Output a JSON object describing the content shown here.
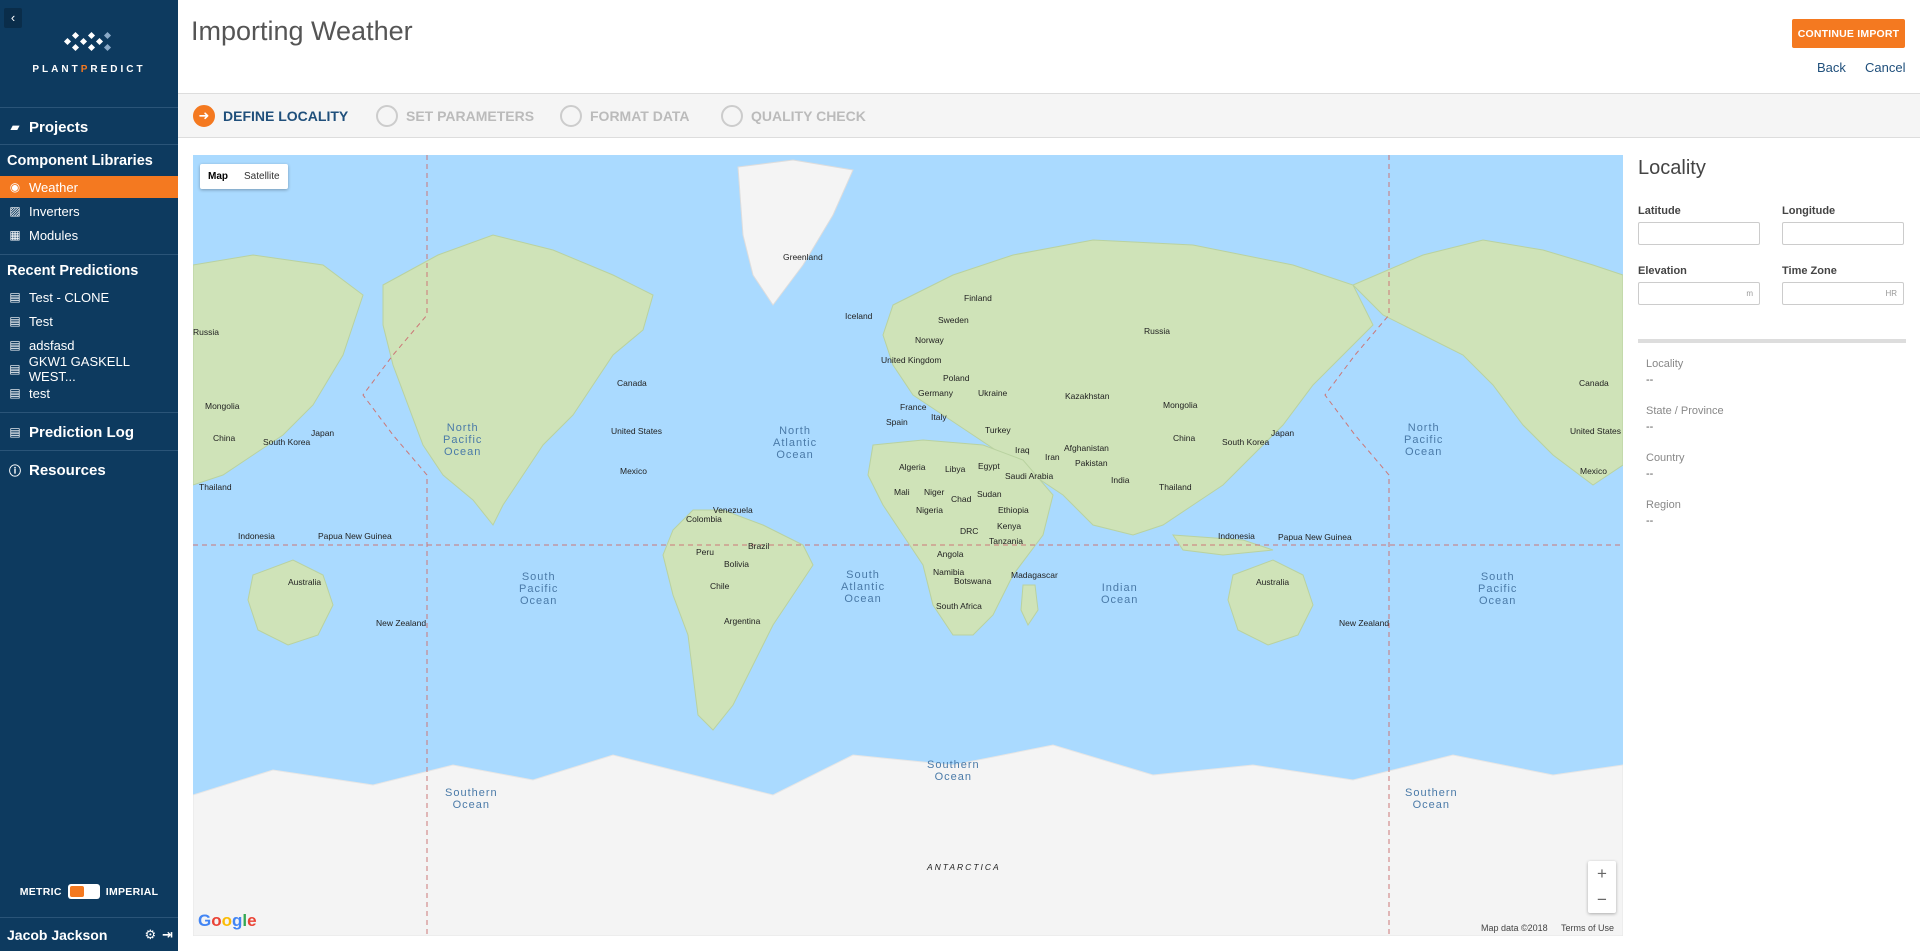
{
  "sidebar": {
    "logo": "PLANTPREDICT",
    "projects": "Projects",
    "component_libraries": "Component Libraries",
    "libraries": [
      {
        "label": "Weather"
      },
      {
        "label": "Inverters"
      },
      {
        "label": "Modules"
      }
    ],
    "recent_predictions": "Recent Predictions",
    "recent": [
      {
        "label": "Test - CLONE"
      },
      {
        "label": "Test"
      },
      {
        "label": "adsfasd"
      },
      {
        "label": "GKW1 GASKELL WEST..."
      },
      {
        "label": "test"
      }
    ],
    "prediction_log": "Prediction Log",
    "resources": "Resources",
    "metric": "METRIC",
    "imperial": "IMPERIAL",
    "user": "Jacob Jackson"
  },
  "header": {
    "title": "Importing Weather",
    "continue": "CONTINUE IMPORT",
    "back": "Back",
    "cancel": "Cancel"
  },
  "steps": [
    {
      "label": "DEFINE LOCALITY"
    },
    {
      "label": "SET PARAMETERS"
    },
    {
      "label": "FORMAT DATA"
    },
    {
      "label": "QUALITY CHECK"
    }
  ],
  "map": {
    "type_map": "Map",
    "type_satellite": "Satellite",
    "zoom_in": "+",
    "zoom_out": "−",
    "google": "Google",
    "map_data": "Map data ©2018",
    "terms": "Terms of Use",
    "labels": [
      "Greenland",
      "Iceland",
      "Finland",
      "Sweden",
      "Norway",
      "Russia",
      "United Kingdom",
      "Poland",
      "Germany",
      "Ukraine",
      "France",
      "Italy",
      "Spain",
      "Kazakhstan",
      "Mongolia",
      "Turkey",
      "Afghanistan",
      "Iraq",
      "Iran",
      "Pakistan",
      "China",
      "South Korea",
      "Japan",
      "India",
      "Thailand",
      "Algeria",
      "Libya",
      "Egypt",
      "Saudi Arabia",
      "Mali",
      "Niger",
      "Chad",
      "Sudan",
      "Nigeria",
      "Ethiopia",
      "DRC",
      "Kenya",
      "Tanzania",
      "Angola",
      "Namibia",
      "Botswana",
      "Madagascar",
      "South Africa",
      "Canada",
      "United States",
      "Mexico",
      "Venezuela",
      "Colombia",
      "Brazil",
      "Peru",
      "Bolivia",
      "Chile",
      "Argentina",
      "Indonesia",
      "Papua New Guinea",
      "Australia",
      "New Zealand",
      "Russia",
      "Mongolia",
      "China",
      "South Korea",
      "Japan",
      "Thailand",
      "Indonesia",
      "Papua New Guinea",
      "Australia",
      "New Zealand",
      "Canada",
      "United States",
      "Mexico",
      "ANTARCTICA"
    ],
    "oceans": [
      "North\nPacific\nOcean",
      "North\nAtlantic\nOcean",
      "South\nPacific\nOcean",
      "South\nAtlantic\nOcean",
      "Indian\nOcean",
      "Southern\nOcean",
      "Southern\nOcean",
      "North\nPacific\nOcean",
      "South\nPacific\nOcean",
      "Southern\nOcean"
    ]
  },
  "locality": {
    "title": "Locality",
    "latitude": "Latitude",
    "longitude": "Longitude",
    "elevation": "Elevation",
    "elevation_unit": "m",
    "timezone": "Time Zone",
    "timezone_unit": "HR",
    "info": [
      {
        "label": "Locality",
        "value": "--"
      },
      {
        "label": "State / Province",
        "value": "--"
      },
      {
        "label": "Country",
        "value": "--"
      },
      {
        "label": "Region",
        "value": "--"
      }
    ]
  }
}
